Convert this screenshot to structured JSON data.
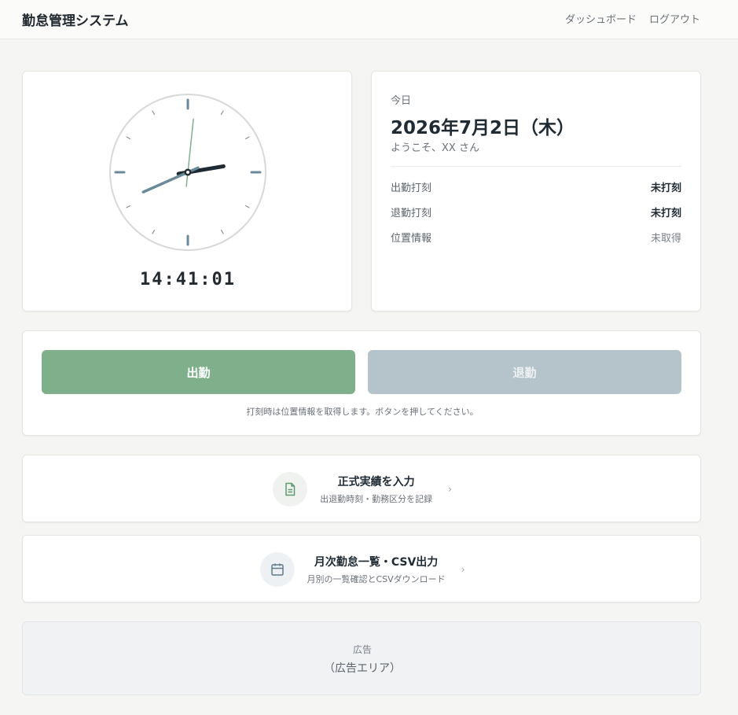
{
  "header": {
    "app_title": "勤怠管理システム",
    "nav": {
      "dashboard": "ダッシュボード",
      "logout": "ログアウト"
    }
  },
  "clock": {
    "digital": "14:41:01",
    "hours": 14,
    "minutes": 41,
    "seconds": 1,
    "colors": {
      "hour_hand": "#1f2a33",
      "minute_hand": "#6b8a99",
      "second_hand": "#7fb08b",
      "marks": "#6b8a99"
    }
  },
  "today": {
    "label": "今日",
    "date": "2026年7月2日（木）",
    "welcome": "ようこそ、XX さん",
    "rows": [
      {
        "label": "出勤打刻",
        "value": "未打刻"
      },
      {
        "label": "退勤打刻",
        "value": "未打刻"
      },
      {
        "label": "位置情報",
        "value": "未取得"
      }
    ]
  },
  "punch": {
    "clock_in_label": "出勤",
    "clock_out_label": "退勤",
    "clock_out_enabled": false,
    "note": "打刻時は位置情報を取得します。ボタンを押してください。",
    "colors": {
      "clock_in": "#7fb08b",
      "clock_out_disabled": "#b5c3cb"
    }
  },
  "links": [
    {
      "title": "正式実績を入力",
      "subtitle": "出退勤時刻・勤務区分を記録",
      "icon": "document-icon",
      "chevron": "›"
    },
    {
      "title": "月次勤怠一覧・CSV出力",
      "subtitle": "月別の一覧確認とCSVダウンロード",
      "icon": "calendar-icon",
      "chevron": "›"
    }
  ],
  "ad": {
    "label": "広告",
    "area": "（広告エリア）"
  }
}
